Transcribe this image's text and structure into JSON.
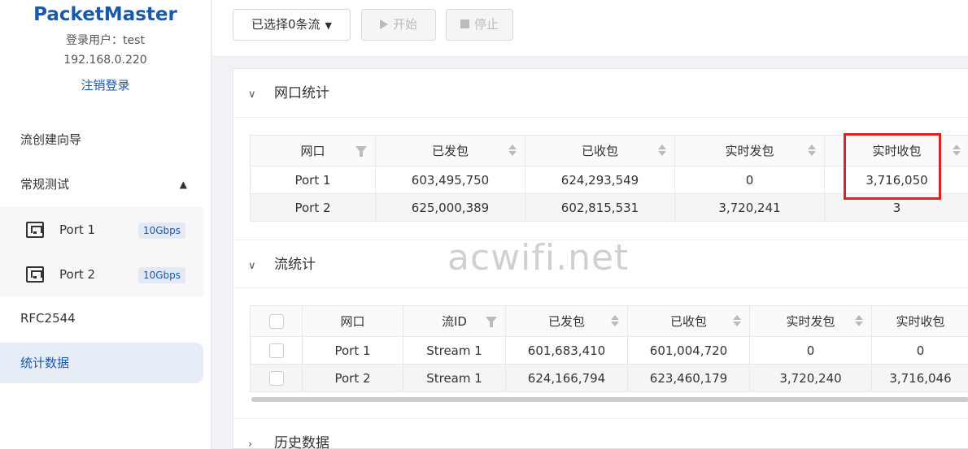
{
  "brand": {
    "title": "PacketMaster",
    "user": "登录用户：test",
    "ip": "192.168.0.220",
    "logout": "注销登录"
  },
  "menu": {
    "wizard": "流创建向导",
    "regular": "常规测试",
    "ports": [
      {
        "label": "Port 1",
        "speed": "10Gbps"
      },
      {
        "label": "Port 2",
        "speed": "10Gbps"
      }
    ],
    "rfc": "RFC2544",
    "stats": "统计数据"
  },
  "toolbar": {
    "select": "已选择0条流",
    "start": "开始",
    "stop": "停止"
  },
  "port_stats": {
    "title": "网口统计",
    "headers": [
      "网口",
      "已发包",
      "已收包",
      "实时发包",
      "实时收包"
    ],
    "rows": [
      [
        "Port 1",
        "603,495,750",
        "624,293,549",
        "0",
        "3,716,050"
      ],
      [
        "Port 2",
        "625,000,389",
        "602,815,531",
        "3,720,241",
        "3"
      ]
    ]
  },
  "flow_stats": {
    "title": "流统计",
    "headers": [
      "网口",
      "流ID",
      "已发包",
      "已收包",
      "实时发包",
      "实时收包"
    ],
    "rows": [
      [
        "Port 1",
        "Stream 1",
        "601,683,410",
        "601,004,720",
        "0",
        "0"
      ],
      [
        "Port 2",
        "Stream 1",
        "624,166,794",
        "623,460,179",
        "3,720,240",
        "3,716,046"
      ]
    ]
  },
  "history": {
    "title": "历史数据"
  },
  "watermark": "acwifi.net",
  "colors": {
    "brand": "#1a58a8",
    "highlight": "#e02020"
  }
}
